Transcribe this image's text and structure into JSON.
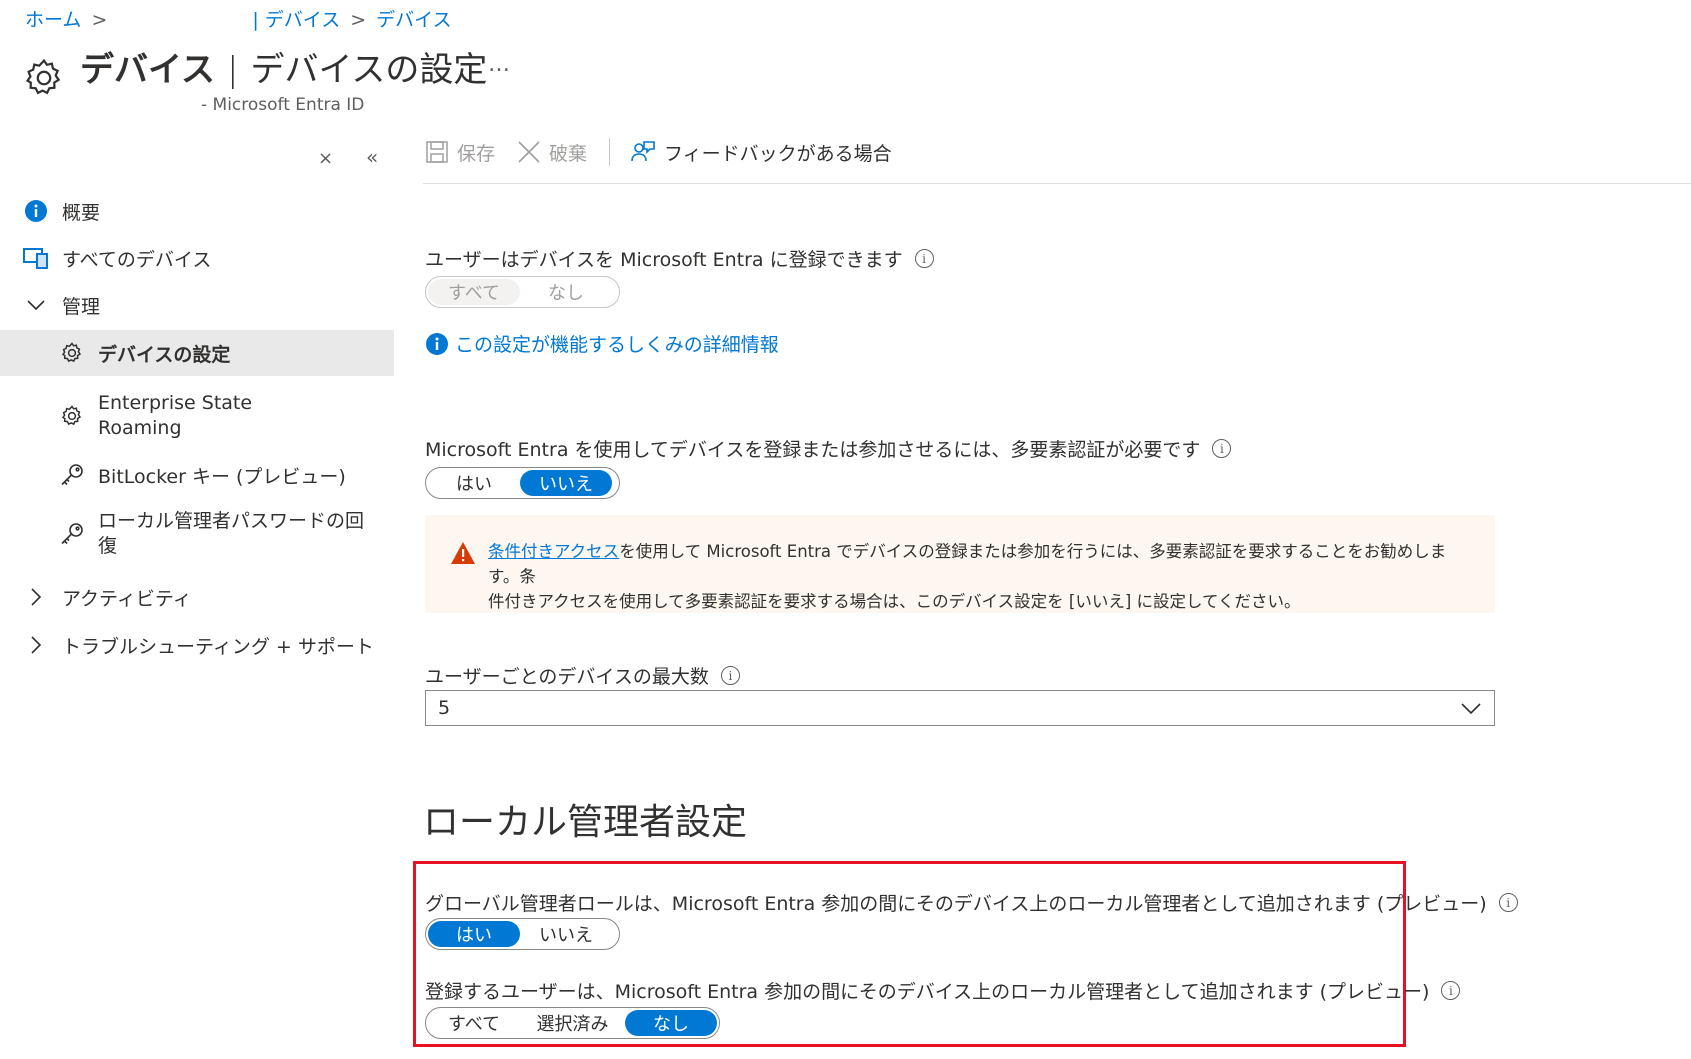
{
  "breadcrumb": {
    "home": "ホーム",
    "devices1": "| デバイス",
    "devices2": "デバイス"
  },
  "header": {
    "title_bold": "デバイス",
    "title_rest": "デバイスの設定",
    "more": "…",
    "subtitle": "- Microsoft Entra ID"
  },
  "sidebar": {
    "close_glyph": "×",
    "collapse_glyph": "«",
    "items": [
      {
        "label": "概要",
        "icon": "info-icon"
      },
      {
        "label": "すべてのデバイス",
        "icon": "devices-icon"
      },
      {
        "label": "管理",
        "icon": "chevron-down-icon"
      },
      {
        "label": "デバイスの設定",
        "icon": "gear-icon"
      },
      {
        "label_line1": "Enterprise State",
        "label_line2": "Roaming",
        "icon": "gear-icon"
      },
      {
        "label": "BitLocker キー (プレビュー)",
        "icon": "key-icon"
      },
      {
        "label_line1": "ローカル管理者パスワードの回",
        "label_line2": "復",
        "icon": "key-icon"
      },
      {
        "label": "アクティビティ",
        "icon": "chevron-right-icon"
      },
      {
        "label": "トラブルシューティング + サポート",
        "icon": "chevron-right-icon"
      }
    ]
  },
  "toolbar": {
    "save": "保存",
    "discard": "破棄",
    "feedback": "フィードバックがある場合"
  },
  "settings": {
    "register": {
      "label": "ユーザーはデバイスを Microsoft Entra に登録できます",
      "options": [
        "すべて",
        "なし"
      ],
      "selected": "すべて",
      "disabled": true
    },
    "learn_more": "この設定が機能するしくみの詳細情報",
    "mfa": {
      "label": "Microsoft Entra を使用してデバイスを登録または参加させるには、多要素認証が必要です",
      "options": [
        "はい",
        "いいえ"
      ],
      "selected": "いいえ"
    },
    "warning": {
      "link": "条件付きアクセス",
      "line1_rest": "を使用して Microsoft Entra でデバイスの登録または参加を行うには、多要素認証を要求することをお勧めします。条",
      "line2": "件付きアクセスを使用して多要素認証を要求する場合は、このデバイス設定を [いいえ] に設定してください。"
    },
    "max_devices": {
      "label": "ユーザーごとのデバイスの最大数",
      "value": "5"
    }
  },
  "local_admin": {
    "title": "ローカル管理者設定",
    "global_admin": {
      "label": "グローバル管理者ロールは、Microsoft Entra 参加の間にそのデバイス上のローカル管理者として追加されます (プレビュー)",
      "options": [
        "はい",
        "いいえ"
      ],
      "selected": "はい"
    },
    "registering_user": {
      "label": "登録するユーザーは、Microsoft Entra 参加の間にそのデバイス上のローカル管理者として追加されます (プレビュー)",
      "options": [
        "すべて",
        "選択済み",
        "なし"
      ],
      "selected": "なし"
    }
  },
  "colors": {
    "accent": "#0078d4",
    "highlight": "#e81123",
    "warning_bg": "#fdf6f1",
    "warning_icon": "#d83b01"
  }
}
